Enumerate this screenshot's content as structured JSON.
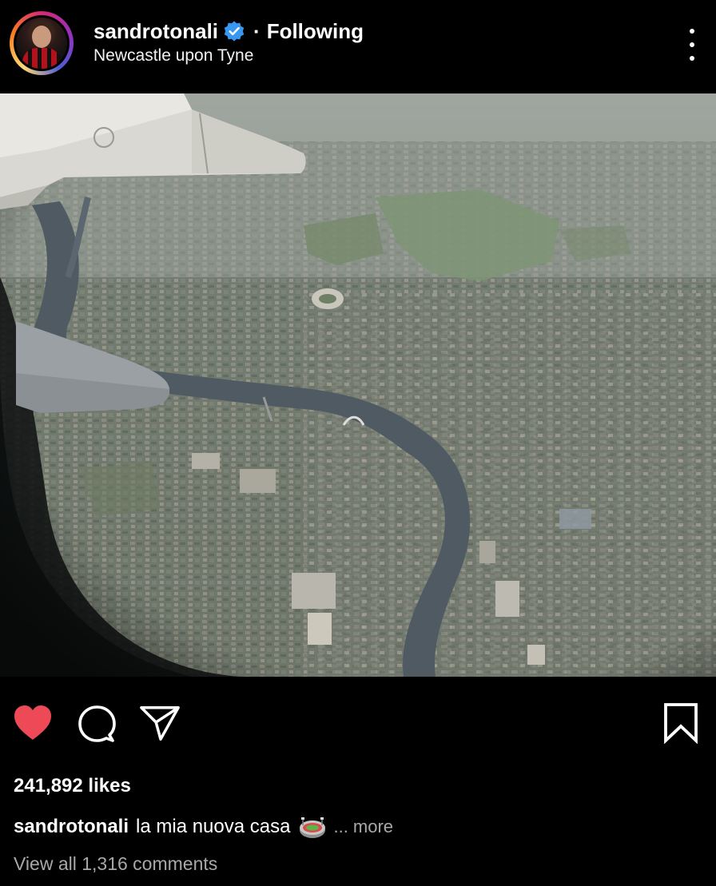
{
  "header": {
    "username": "sandrotonali",
    "separator": "·",
    "follow_status": "Following",
    "location": "Newcastle upon Tyne",
    "verified_icon": "verified-badge-icon",
    "more_icon": "more-options-icon"
  },
  "actions": {
    "like_icon": "heart-filled-icon",
    "comment_icon": "comment-bubble-icon",
    "share_icon": "paper-plane-icon",
    "save_icon": "bookmark-icon",
    "like_color": "#ed4956"
  },
  "post": {
    "likes": "241,892 likes",
    "caption_user": "sandrotonali",
    "caption_text": "la mia nuova casa",
    "caption_emoji": "stadium-emoji",
    "caption_more": "... more",
    "view_comments": "View all 1,316 comments"
  },
  "colors": {
    "background": "#000000",
    "text": "#ffffff",
    "muted": "#a8a8a8",
    "verified": "#3897f0"
  }
}
